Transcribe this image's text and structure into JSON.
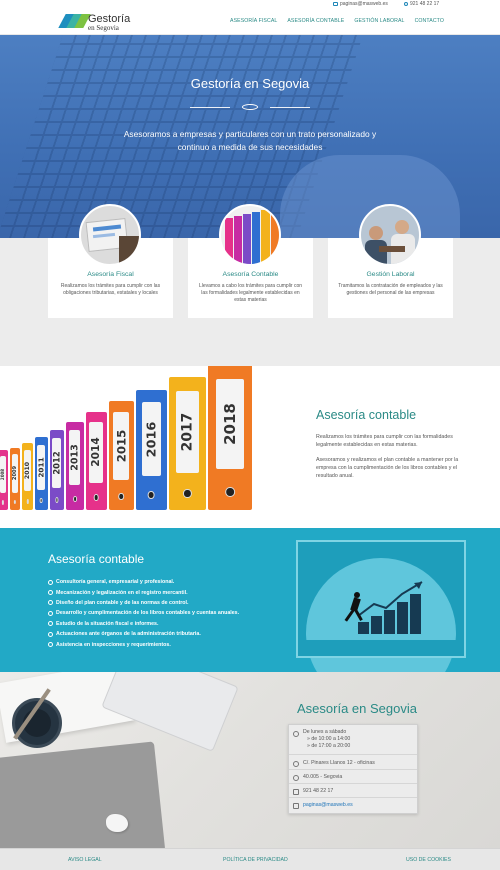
{
  "topbar": {
    "email": "paginas@masweb.es",
    "phone": "921 48 22 17"
  },
  "logo": {
    "line1": "Gestoría",
    "line2": "en Segovia",
    "colors": [
      "#1e8fbf",
      "#3bb3a4",
      "#7dc242"
    ]
  },
  "nav": {
    "items": [
      "ASESORÍA FISCAL",
      "ASESORÍA CONTABLE",
      "GESTIÓN LABORAL",
      "CONTACTO"
    ]
  },
  "hero": {
    "title": "Gestoría en Segovia",
    "tagline": "Asesoramos a empresas y particulares con un trato personalizado y continuo a medida de sus necesidades"
  },
  "services": [
    {
      "title": "Asesoría Fiscal",
      "desc": "Realizamos los trámites para cumplir con las obligaciones tributarias, estatales y locales"
    },
    {
      "title": "Asesoría Contable",
      "desc": "Llevamos a cabo los trámites para cumplir con las formalidades legalmente establecidas en estas materias"
    },
    {
      "title": "Gestión Laboral",
      "desc": "Tramitamos la contratación de empleados y las gestiones del personal de las empresas"
    }
  ],
  "contable": {
    "title": "Asesoría contable",
    "p1": "Realizamos los trámites para cumplir con las formalidades legalmente establecidas en estas materias.",
    "p2": "Asesoramos y realizamos el plan contable a mantener por la empresa con la cumplimentación de los libros contables y el resultado anual.",
    "binder_years": [
      "2008",
      "2009",
      "2010",
      "2011",
      "2012",
      "2013",
      "2014",
      "2015",
      "2016",
      "2017",
      "2018"
    ]
  },
  "contable_list": {
    "title": "Asesoría contable",
    "items": [
      "Consultoría general, empresarial y profesional.",
      "Mecanización y legalización en el registro mercantil.",
      "Diseño del plan contable y de las normas de control.",
      "Desarrollo y cumplimentación de los libros contables y cuentas anuales.",
      "Estudio de la situación fiscal e informes.",
      "Actuaciones ante órganos de la administración tributaria.",
      "Asistencia en inspecciones y requerimientos."
    ]
  },
  "contact": {
    "title": "Asesoría en Segovia",
    "hours_title": "De lunes a sábado",
    "hours_1": "» de 10:00 a 14:00",
    "hours_2": "» de 17:00 a 20:00",
    "address": "C/. Pinares Llanos 12 - oficinas",
    "city": "40.005 - Segovia",
    "phone": "921 48 22 17",
    "email": "paginas@masweb.es"
  },
  "footer": {
    "legal": "AVISO LEGAL",
    "privacy": "POLÍTICA DE PRIVACIDAD",
    "cookies": "USO DE COOKIES"
  }
}
